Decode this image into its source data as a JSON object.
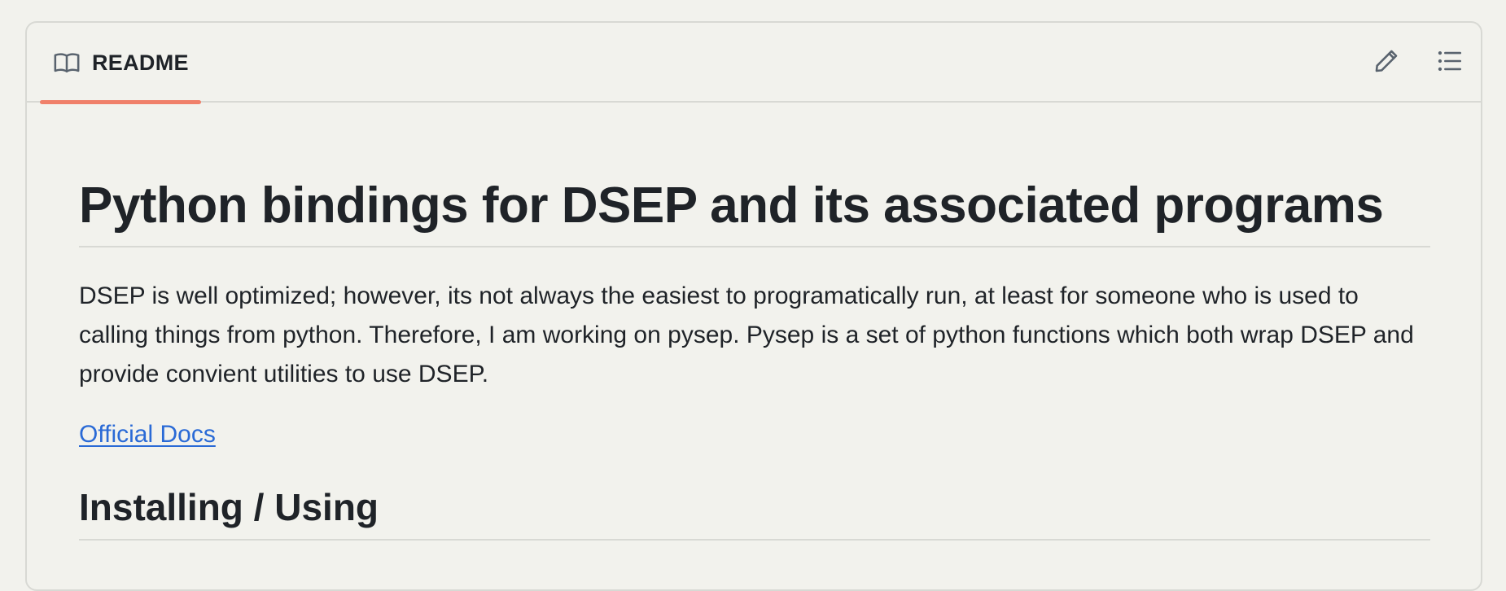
{
  "readme": {
    "tab_label": "README",
    "tab_icon": "book-icon",
    "active_tab_color": "#f0806a",
    "actions": [
      {
        "name": "edit-button",
        "icon": "pencil-icon"
      },
      {
        "name": "outline-button",
        "icon": "list-unordered-icon"
      }
    ]
  },
  "content": {
    "h1": "Python bindings for DSEP and its associated programs",
    "paragraph": "DSEP is well optimized; however, its not always the easiest to programatically run, at least for someone who is used to calling things from python. Therefore, I am working on pysep. Pysep is a set of python functions which both wrap DSEP and provide convient utilities to use DSEP.",
    "link_text": "Official Docs",
    "link_color": "#2a6ad6",
    "h2": "Installing / Using"
  }
}
